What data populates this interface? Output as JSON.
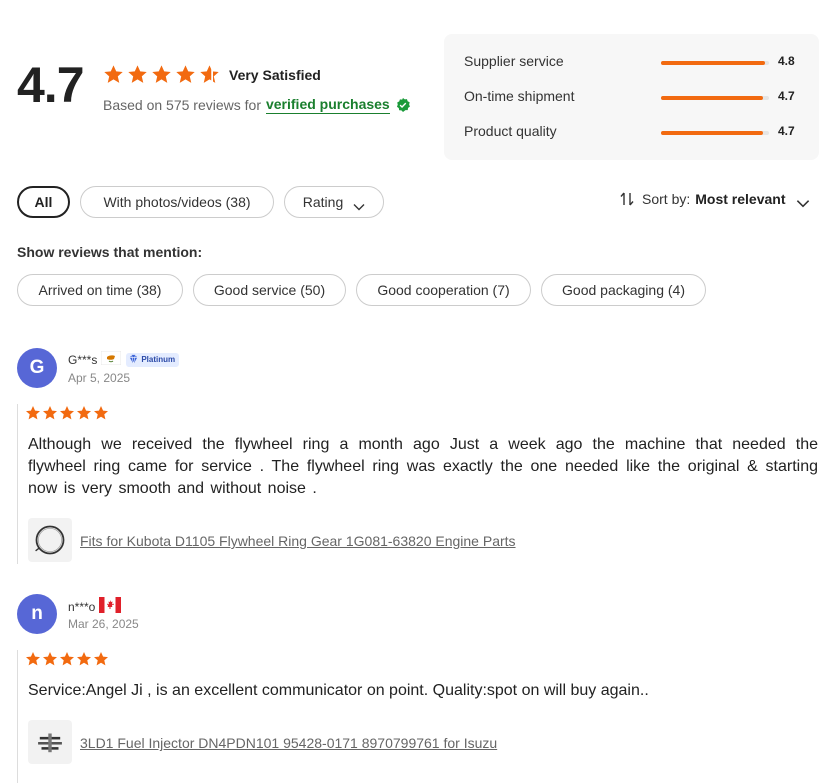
{
  "summary": {
    "score": "4.7",
    "rating_value": 4.7,
    "satisfaction": "Very Satisfied",
    "based_on": "Based on 575 reviews for",
    "verified": "verified purchases"
  },
  "metrics": [
    {
      "label": "Supplier service",
      "value": "4.8",
      "fraction": 0.96
    },
    {
      "label": "On-time shipment",
      "value": "4.7",
      "fraction": 0.94
    },
    {
      "label": "Product quality",
      "value": "4.7",
      "fraction": 0.94
    }
  ],
  "filters": {
    "all": "All",
    "photos": "With photos/videos (38)",
    "rating": "Rating",
    "sort_label": "Sort by:",
    "sort_value": "Most relevant"
  },
  "mentions": {
    "title": "Show reviews that mention:",
    "tags": [
      "Arrived on time (38)",
      "Good service (50)",
      "Good cooperation (7)",
      "Good packaging (4)"
    ]
  },
  "reviews": [
    {
      "initial": "G",
      "name": "G***s",
      "badge": "Platinum",
      "date": "Apr 5, 2025",
      "stars": 5,
      "text": "Although we received the flywheel ring a month ago Just a week ago the machine that needed the flywheel ring came for service . The flywheel ring was exactly the one needed like the original & starting now is very smooth and without noise .",
      "product": "Fits for Kubota D1105 Flywheel Ring Gear 1G081-63820 Engine Parts"
    },
    {
      "initial": "n",
      "name": "n***o",
      "date": "Mar 26, 2025",
      "stars": 5,
      "text": "Service:Angel Ji , is an excellent communicator on point. Quality:spot on will buy again..",
      "product": "3LD1 Fuel Injector DN4PDN101 95428-0171 8970799761 for Isuzu"
    }
  ],
  "colors": {
    "accent": "#f26a10",
    "verified": "#1a7f2e",
    "avatar": "#5767d6"
  }
}
